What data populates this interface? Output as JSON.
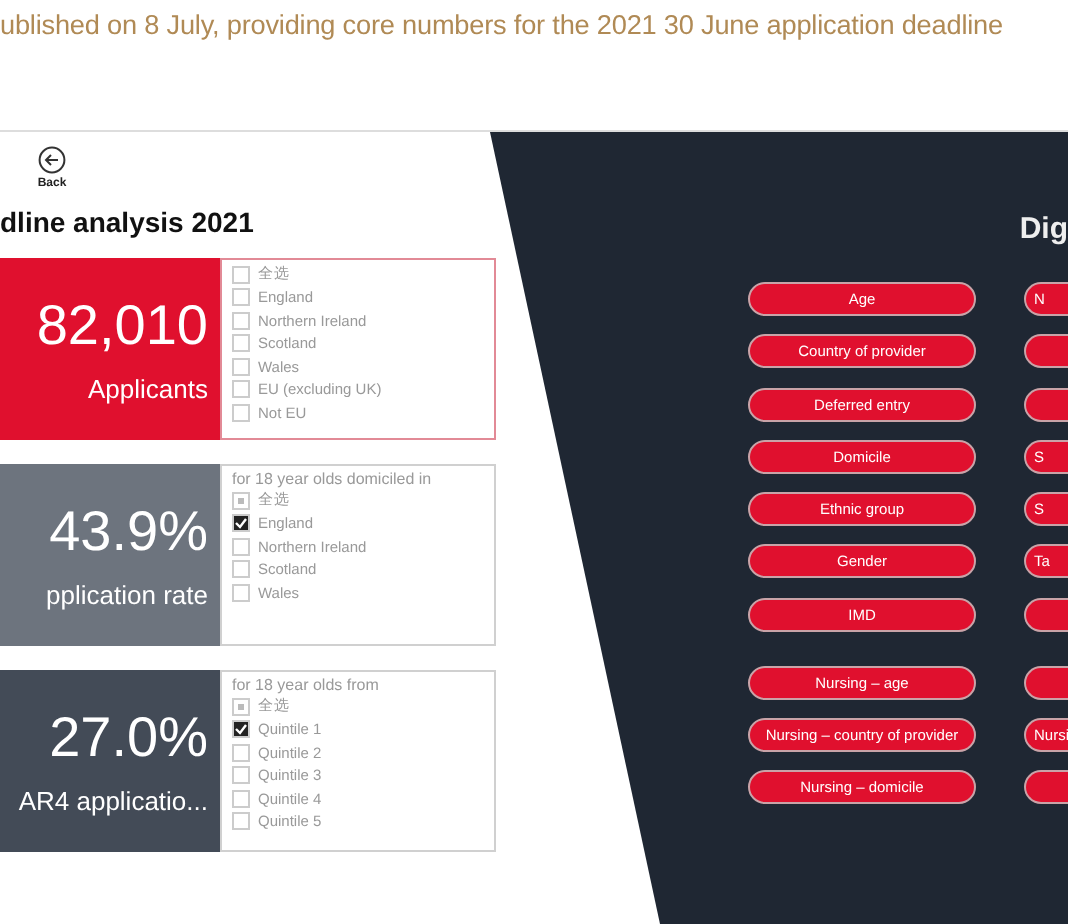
{
  "header": {
    "text": "ublished on 8 July, providing core numbers for the 2021 30 June application deadline"
  },
  "back": {
    "label": "Back"
  },
  "title": "dline analysis 2021",
  "cards": [
    {
      "color": "#e0102e",
      "value": "82,010",
      "caption": "Applicants",
      "options": [
        {
          "kind": "select_all",
          "label": "全选",
          "indeterminate": false
        },
        {
          "kind": "option",
          "label": "England",
          "checked": false
        },
        {
          "kind": "option",
          "label": "Northern Ireland",
          "checked": false
        },
        {
          "kind": "option",
          "label": "Scotland",
          "checked": false
        },
        {
          "kind": "option",
          "label": "Wales",
          "checked": false
        },
        {
          "kind": "option",
          "label": "EU (excluding UK)",
          "checked": false
        },
        {
          "kind": "option",
          "label": "Not EU",
          "checked": false
        }
      ]
    },
    {
      "color": "#6d747e",
      "value": "43.9%",
      "caption": "pplication rate",
      "note": "for 18 year olds domiciled in",
      "options": [
        {
          "kind": "select_all",
          "label": "全选",
          "indeterminate": true
        },
        {
          "kind": "option",
          "label": "England",
          "checked": true
        },
        {
          "kind": "option",
          "label": "Northern Ireland",
          "checked": false
        },
        {
          "kind": "option",
          "label": "Scotland",
          "checked": false
        },
        {
          "kind": "option",
          "label": "Wales",
          "checked": false
        }
      ]
    },
    {
      "color": "#434b57",
      "value": "27.0%",
      "caption": "AR4 applicatio...",
      "note": "for 18 year olds from",
      "options": [
        {
          "kind": "select_all",
          "label": "全选",
          "indeterminate": true
        },
        {
          "kind": "option",
          "label": "Quintile 1",
          "checked": true
        },
        {
          "kind": "option",
          "label": "Quintile 2",
          "checked": false
        },
        {
          "kind": "option",
          "label": "Quintile 3",
          "checked": false
        },
        {
          "kind": "option",
          "label": "Quintile 4",
          "checked": false
        },
        {
          "kind": "option",
          "label": "Quintile 5",
          "checked": false
        }
      ]
    }
  ],
  "panel": {
    "heading": "Dig",
    "groups": [
      {
        "rows": [
          {
            "left": "Age",
            "right": "N"
          },
          {
            "left": "Country of provider"
          },
          {
            "left": "Deferred entry"
          },
          {
            "left": "Domicile",
            "right": "S"
          },
          {
            "left": "Ethnic group",
            "right": "S"
          },
          {
            "left": "Gender",
            "right": "Ta"
          },
          {
            "left": "IMD"
          }
        ]
      },
      {
        "rows": [
          {
            "left": "Nursing – age"
          },
          {
            "left": "Nursing – country of provider",
            "right": "Nursi"
          },
          {
            "left": "Nursing – domicile"
          }
        ]
      }
    ]
  }
}
